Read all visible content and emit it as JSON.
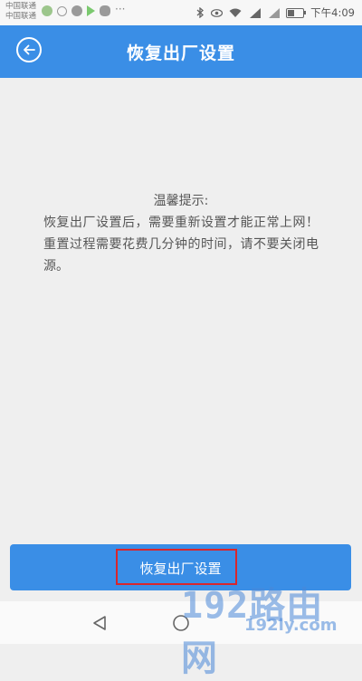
{
  "status_bar": {
    "carrier_1": "中国联通",
    "carrier_2": "中国联通",
    "time": "下午4:09",
    "battery_level": 0.4,
    "icons": [
      "app-round-icon",
      "app-outline-icon",
      "message-icon",
      "video-icon",
      "wechat-icon",
      "more-dots-icon",
      "bluetooth-icon",
      "eye-icon",
      "wifi-icon",
      "signal-4g-icon",
      "signal-2g-icon",
      "battery-icon"
    ]
  },
  "header": {
    "title": "恢复出厂设置",
    "back_icon": "back-arrow-icon"
  },
  "notice": {
    "heading": "温馨提示:",
    "body": "恢复出厂设置后，需要重新设置才能正常上网！重置过程需要花费几分钟的时间，请不要关闭电源。"
  },
  "reset_button": {
    "label": "恢复出厂设置"
  },
  "watermark": {
    "big": "192路由网",
    "small": "192ly.com"
  },
  "colors": {
    "accent": "#3a8ee6",
    "background": "#efefef",
    "highlight": "#d9262c"
  }
}
